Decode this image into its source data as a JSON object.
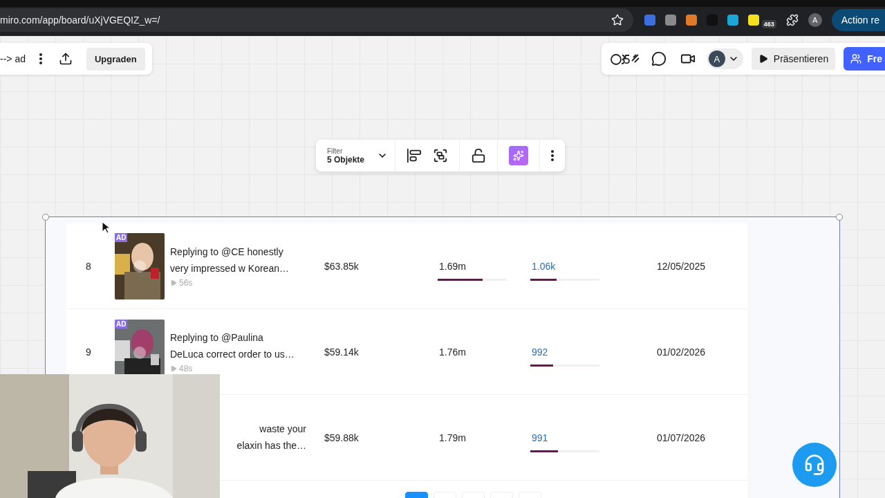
{
  "browser": {
    "address": "miro.com/app/board/uXjVGEQIZ_w=/",
    "extension_badge": "463",
    "profile": "A",
    "action_button": "Action re"
  },
  "board_toolbar": {
    "board_name": "--> ad",
    "upgrade": "Upgraden"
  },
  "collab_toolbar": {
    "avatar": "A",
    "present": "Präsentieren",
    "share": "Fre"
  },
  "selection_toolbar": {
    "label": "Filter",
    "value": "5 Objekte",
    "ai_active": true
  },
  "table": {
    "rows": [
      {
        "kind": "video",
        "number": "8",
        "ad_tag": "AD",
        "title": [
          "Replying to @CE honestly",
          "very impressed w Korean…"
        ],
        "duration": "56s",
        "revenue": "$63.85k",
        "views": "1.69m",
        "views_bar": {
          "level": 0.65
        },
        "column_3": "1.06k",
        "column_3_bar": {
          "level": 0.38
        },
        "date": "12/05/2025"
      },
      {
        "kind": "video_cut",
        "number": "9",
        "ad_tag": "AD",
        "title": [
          "Replying to @Paulina",
          "DeLuca correct order to us…"
        ],
        "duration": "48s",
        "revenue": "$59.14k",
        "views": "1.76m",
        "column_3": "992",
        "column_3_bar": {
          "level": 0.33
        },
        "date": "01/02/2026"
      },
      {
        "kind": "partial",
        "title": [
          "waste your",
          "elaxin has the…"
        ],
        "revenue": "$59.88k",
        "views": "1.79m",
        "column_3": "991",
        "column_3_bar": {
          "level": 0.4
        },
        "date": "01/07/2026"
      }
    ]
  },
  "pagination": [
    {
      "selected": true
    },
    {
      "selected": false
    },
    {
      "selected": false
    },
    {
      "selected": false
    },
    {
      "selected": false
    }
  ]
}
